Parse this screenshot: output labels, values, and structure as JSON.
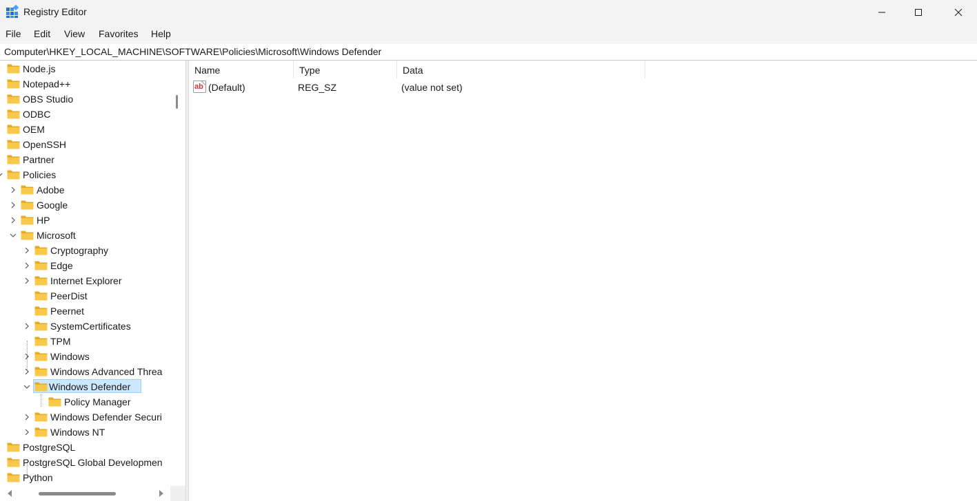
{
  "window": {
    "title": "Registry Editor"
  },
  "menu": [
    "File",
    "Edit",
    "View",
    "Favorites",
    "Help"
  ],
  "address": "Computer\\HKEY_LOCAL_MACHINE\\SOFTWARE\\Policies\\Microsoft\\Windows Defender",
  "tree": [
    {
      "label": "Node.js",
      "level": 0,
      "expander": "none"
    },
    {
      "label": "Notepad++",
      "level": 0,
      "expander": "none"
    },
    {
      "label": "OBS Studio",
      "level": 0,
      "expander": "none"
    },
    {
      "label": "ODBC",
      "level": 0,
      "expander": "none"
    },
    {
      "label": "OEM",
      "level": 0,
      "expander": "none"
    },
    {
      "label": "OpenSSH",
      "level": 0,
      "expander": "none"
    },
    {
      "label": "Partner",
      "level": 0,
      "expander": "none"
    },
    {
      "label": "Policies",
      "level": 0,
      "expander": "expanded"
    },
    {
      "label": "Adobe",
      "level": 1,
      "expander": "collapsed"
    },
    {
      "label": "Google",
      "level": 1,
      "expander": "collapsed"
    },
    {
      "label": "HP",
      "level": 1,
      "expander": "collapsed"
    },
    {
      "label": "Microsoft",
      "level": 1,
      "expander": "expanded"
    },
    {
      "label": "Cryptography",
      "level": 2,
      "expander": "collapsed"
    },
    {
      "label": "Edge",
      "level": 2,
      "expander": "collapsed"
    },
    {
      "label": "Internet Explorer",
      "level": 2,
      "expander": "collapsed"
    },
    {
      "label": "PeerDist",
      "level": 2,
      "expander": "none"
    },
    {
      "label": "Peernet",
      "level": 2,
      "expander": "none"
    },
    {
      "label": "SystemCertificates",
      "level": 2,
      "expander": "collapsed"
    },
    {
      "label": "TPM",
      "level": 2,
      "expander": "none"
    },
    {
      "label": "Windows",
      "level": 2,
      "expander": "collapsed"
    },
    {
      "label": "Windows Advanced Threa",
      "level": 2,
      "expander": "collapsed"
    },
    {
      "label": "Windows Defender",
      "level": 2,
      "expander": "expanded",
      "selected": true
    },
    {
      "label": "Policy Manager",
      "level": 3,
      "expander": "none"
    },
    {
      "label": "Windows Defender Securi",
      "level": 2,
      "expander": "collapsed"
    },
    {
      "label": "Windows NT",
      "level": 2,
      "expander": "collapsed"
    },
    {
      "label": "PostgreSQL",
      "level": 0,
      "expander": "none"
    },
    {
      "label": "PostgreSQL Global Developmen",
      "level": 0,
      "expander": "none"
    },
    {
      "label": "Python",
      "level": 0,
      "expander": "none"
    }
  ],
  "list": {
    "columns": [
      "Name",
      "Type",
      "Data"
    ],
    "rows": [
      {
        "icon": "string-value-icon",
        "name": "(Default)",
        "type": "REG_SZ",
        "data": "(value not set)"
      }
    ]
  },
  "colors": {
    "selection_bg": "#cce8ff",
    "selection_border": "#99d1ff",
    "folder": "#f8c84a"
  }
}
